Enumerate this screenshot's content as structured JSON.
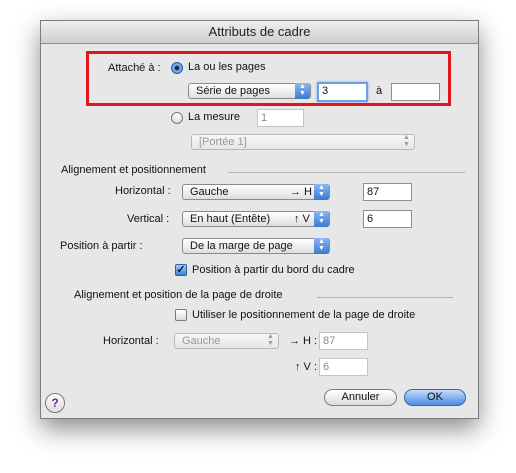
{
  "dialog": {
    "title": "Attributs de cadre"
  },
  "attach": {
    "label": "Attaché à :",
    "pages_option": "La ou les pages",
    "page_series_popup": "Série de pages",
    "start_value": "3",
    "to_label": "à",
    "end_value": "",
    "measure_option": "La mesure",
    "measure_value": "1",
    "staff_popup": "[Portée 1]"
  },
  "alignment": {
    "section_title": "Alignement et positionnement",
    "horizontal_label": "Horizontal :",
    "horizontal_popup": "Gauche",
    "horizontal_marker": "→ H",
    "horizontal_value": "87",
    "vertical_label": "Vertical :",
    "vertical_popup": "En haut (Entête)",
    "vertical_marker": "↑ V",
    "vertical_value": "6",
    "from_label": "Position à partir :",
    "from_popup": "De la marge de page",
    "frame_edge_checkbox": "Position à partir du bord du cadre",
    "frame_edge_checked": true
  },
  "right_page": {
    "section_title": "Alignement et position de la page de droite",
    "use_checkbox": "Utiliser le positionnement de la page de droite",
    "use_checked": false,
    "horizontal_label": "Horizontal :",
    "horizontal_popup": "Gauche",
    "h_marker": "→ H :",
    "h_value": "87",
    "v_marker": "↑ V :",
    "v_value": "6"
  },
  "buttons": {
    "help": "?",
    "cancel": "Annuler",
    "ok": "OK"
  },
  "colors": {
    "highlight_border": "#e0141b",
    "accent": "#3978d0"
  }
}
